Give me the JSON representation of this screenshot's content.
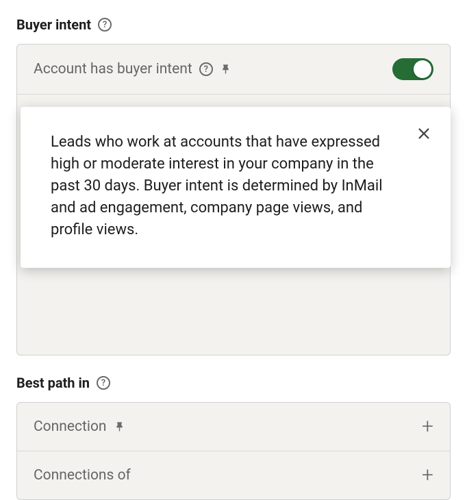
{
  "sections": {
    "buyer_intent": {
      "title": "Buyer intent",
      "filter": {
        "label": "Account has buyer intent",
        "toggle_on": true
      },
      "tooltip_text": "Leads who work at accounts that have expressed high or moderate interest in your company in the past 30 days. Buyer intent is determined by InMail and ad engagement, company page views, and profile views."
    },
    "best_path": {
      "title": "Best path in",
      "filters": [
        {
          "label": "Connection"
        },
        {
          "label": "Connections of"
        }
      ]
    }
  }
}
